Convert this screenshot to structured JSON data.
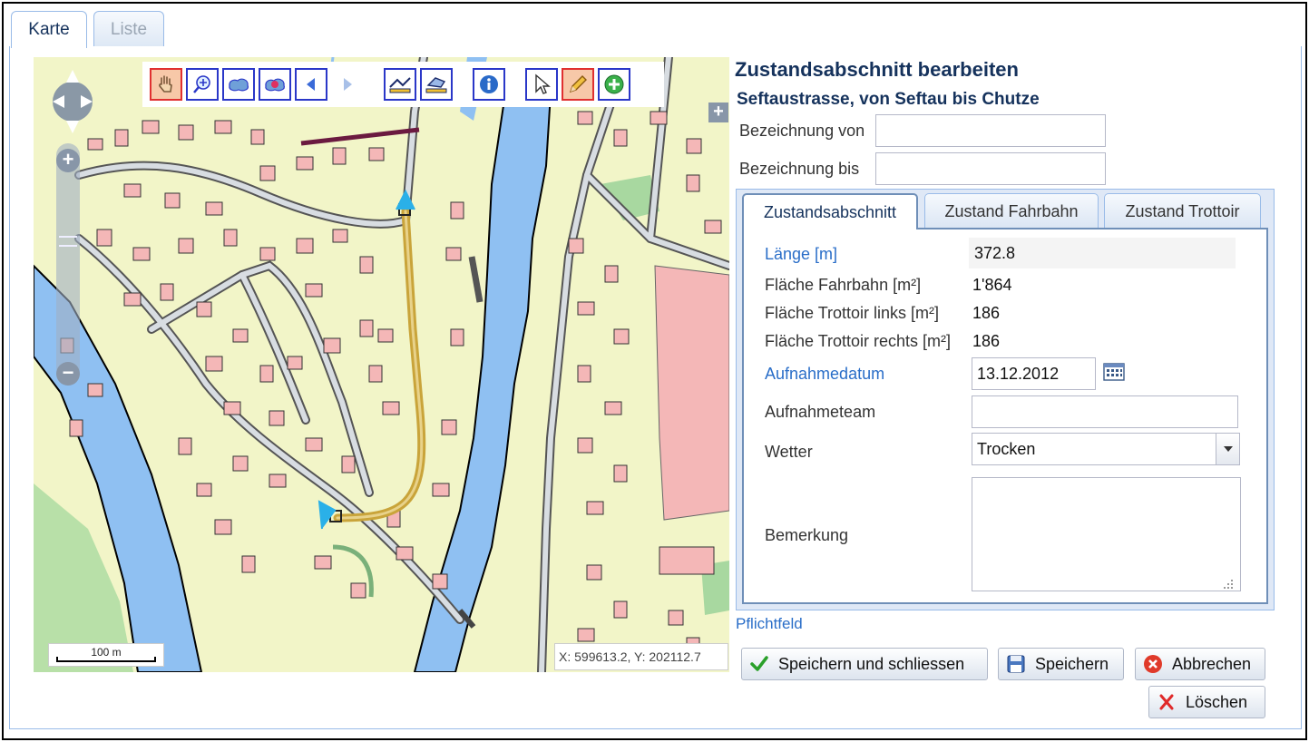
{
  "tabs": {
    "karte": "Karte",
    "liste": "Liste"
  },
  "map": {
    "scale_label": "100 m",
    "coordinates": "X: 599613.2, Y: 202112.7",
    "tool_icons": [
      "pan-hand-icon",
      "zoom-in-icon",
      "zoom-extent-icon",
      "zoom-selection-icon",
      "back-icon",
      "forward-icon",
      "measure-line-icon",
      "measure-area-icon",
      "info-icon",
      "select-icon",
      "edit-pencil-icon",
      "add-icon"
    ]
  },
  "form": {
    "title": "Zustandsabschnitt bearbeiten",
    "subtitle": "Seftaustrasse, von Seftau bis Chutze",
    "bezeichnung_von_label": "Bezeichnung von",
    "bezeichnung_von_value": "",
    "bezeichnung_bis_label": "Bezeichnung bis",
    "bezeichnung_bis_value": "",
    "inner_tabs": [
      "Zustandsabschnitt",
      "Zustand Fahrbahn",
      "Zustand Trottoir"
    ],
    "laenge_label": "Länge [m]",
    "laenge_value": "372.8",
    "flaeche_fahrbahn_label": "Fläche Fahrbahn [m²]",
    "flaeche_fahrbahn_value": "1'864",
    "trottoir_links_label": "Fläche Trottoir links [m²]",
    "trottoir_links_value": "186",
    "trottoir_rechts_label": "Fläche Trottoir rechts [m²]",
    "trottoir_rechts_value": "186",
    "aufnahmedatum_label": "Aufnahmedatum",
    "aufnahmedatum_value": "13.12.2012",
    "aufnahmeteam_label": "Aufnahmeteam",
    "aufnahmeteam_value": "",
    "wetter_label": "Wetter",
    "wetter_value": "Trocken",
    "bemerkung_label": "Bemerkung",
    "bemerkung_value": "",
    "pflichtfeld": "Pflichtfeld"
  },
  "buttons": {
    "save_close": "Speichern und schliessen",
    "save": "Speichern",
    "cancel": "Abbrechen",
    "delete": "Löschen"
  },
  "colors": {
    "accent": "#15325c",
    "required": "#2a6ec8",
    "river": "#8fc0f2",
    "building": "#f4b7b7",
    "road_segment": "#c9a43a"
  }
}
